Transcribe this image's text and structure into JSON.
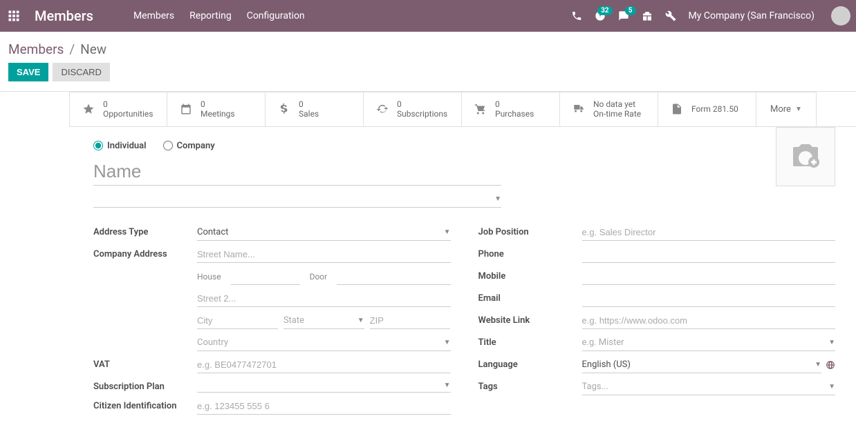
{
  "navbar": {
    "app_title": "Members",
    "links": [
      "Members",
      "Reporting",
      "Configuration"
    ],
    "badges": {
      "clock": "32",
      "messages": "5"
    },
    "company": "My Company (San Francisco)"
  },
  "breadcrumb": {
    "root": "Members",
    "current": "New"
  },
  "actions": {
    "save": "SAVE",
    "discard": "DISCARD"
  },
  "stats": [
    {
      "value": "0",
      "label": "Opportunities",
      "icon": "star"
    },
    {
      "value": "0",
      "label": "Meetings",
      "icon": "calendar"
    },
    {
      "value": "0",
      "label": "Sales",
      "icon": "dollar"
    },
    {
      "value": "0",
      "label": "Subscriptions",
      "icon": "refresh"
    },
    {
      "value": "0",
      "label": "Purchases",
      "icon": "cart"
    },
    {
      "value": "No data yet",
      "label": "On-time Rate",
      "icon": "truck"
    },
    {
      "value": "",
      "label": "Form 281.50",
      "icon": "doc"
    }
  ],
  "stats_more": "More",
  "radio": {
    "individual": "Individual",
    "company": "Company"
  },
  "name_placeholder": "Name",
  "left": {
    "address_type": {
      "label": "Address Type",
      "value": "Contact"
    },
    "company_address": {
      "label": "Company Address",
      "street_ph": "Street Name...",
      "house": "House",
      "door": "Door",
      "street2_ph": "Street 2...",
      "city_ph": "City",
      "state_ph": "State",
      "zip_ph": "ZIP",
      "country_ph": "Country"
    },
    "vat": {
      "label": "VAT",
      "ph": "e.g. BE0477472701"
    },
    "subscription_plan": {
      "label": "Subscription Plan"
    },
    "citizen_id": {
      "label": "Citizen Identification",
      "ph": "e.g. 123455 555 6"
    }
  },
  "right": {
    "job_position": {
      "label": "Job Position",
      "ph": "e.g. Sales Director"
    },
    "phone": {
      "label": "Phone"
    },
    "mobile": {
      "label": "Mobile"
    },
    "email": {
      "label": "Email"
    },
    "website": {
      "label": "Website Link",
      "ph": "e.g. https://www.odoo.com"
    },
    "title": {
      "label": "Title",
      "ph": "e.g. Mister"
    },
    "language": {
      "label": "Language",
      "value": "English (US)"
    },
    "tags": {
      "label": "Tags",
      "ph": "Tags..."
    }
  }
}
